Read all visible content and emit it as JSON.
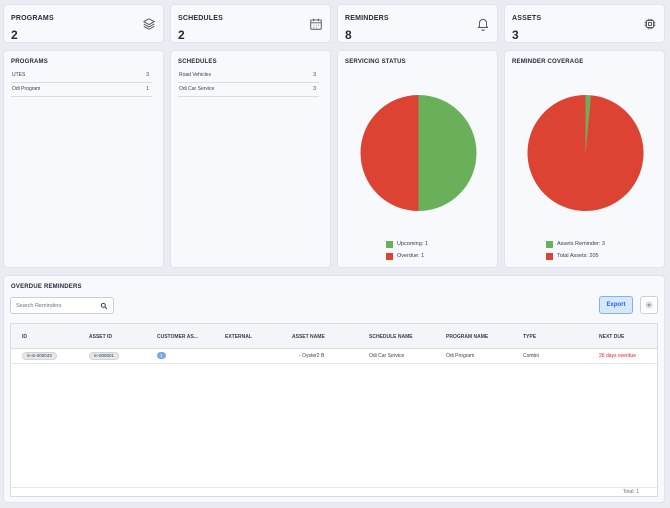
{
  "stats": {
    "programs": {
      "title": "PROGRAMS",
      "value": "2",
      "icon": "layers-icon"
    },
    "schedules": {
      "title": "SCHEDULES",
      "value": "2",
      "icon": "calendar-icon"
    },
    "reminders": {
      "title": "REMINDERS",
      "value": "8",
      "icon": "bell-icon"
    },
    "assets": {
      "title": "ASSETS",
      "value": "3",
      "icon": "chip-icon"
    }
  },
  "programs_panel": {
    "title": "PROGRAMS",
    "items": [
      {
        "label": "UTES",
        "count": "3"
      },
      {
        "label": "Odi Program",
        "count": "1"
      }
    ]
  },
  "schedules_panel": {
    "title": "SCHEDULES",
    "items": [
      {
        "label": "Road Vehicles",
        "count": "3"
      },
      {
        "label": "Odi Car Service",
        "count": "3"
      }
    ]
  },
  "servicing_status": {
    "title": "SERVICING STATUS",
    "legend": [
      {
        "label": "Upcoming: 1",
        "color": "#6aaf5a"
      },
      {
        "label": "Overdue: 1",
        "color": "#dc4333"
      }
    ]
  },
  "reminder_coverage": {
    "title": "REMINDER COVERAGE",
    "legend": [
      {
        "label": "Assets Reminder: 3",
        "color": "#6aaf5a"
      },
      {
        "label": "Total Assets: 205",
        "color": "#dc4333"
      }
    ]
  },
  "chart_data": [
    {
      "type": "pie",
      "categories": [
        "Upcoming",
        "Overdue"
      ],
      "values": [
        1,
        1
      ],
      "colors": [
        "#6aaf5a",
        "#dc4333"
      ],
      "title": "SERVICING STATUS"
    },
    {
      "type": "pie",
      "categories": [
        "Assets Reminder",
        "Total Assets"
      ],
      "values": [
        3,
        205
      ],
      "colors": [
        "#6aaf5a",
        "#dc4333"
      ],
      "title": "REMINDER COVERAGE"
    }
  ],
  "overdue": {
    "title": "OVERDUE REMINDERS",
    "search_placeholder": "Search Reminders",
    "export_label": "Export",
    "columns": [
      "ID",
      "ASSET ID",
      "CUSTOMER AS...",
      "EXTERNAL",
      "ASSET NAME",
      "SCHEDULE NAME",
      "PROGRAM NAME",
      "TYPE",
      "NEXT DUE"
    ],
    "rows": [
      {
        "id": "in-si-000043",
        "asset_id": "in-000001",
        "customer_assets": "1",
        "external": "",
        "asset_name": "- Oyster2 B",
        "schedule_name": "Odi Car Service",
        "program_name": "Odi Program",
        "type": "Combo",
        "next_due": "26 days overdue"
      }
    ],
    "total": "Total: 1"
  }
}
